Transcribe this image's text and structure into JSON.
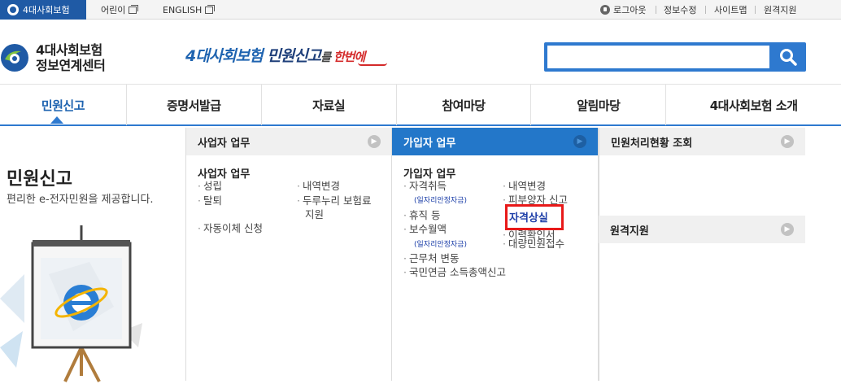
{
  "topbar": {
    "home_tab": "4대사회보험",
    "kids": "어린이",
    "english": "ENGLISH",
    "logout": "로그아웃",
    "edit_info": "정보수정",
    "sitemap": "사이트맵",
    "remote": "원격지원"
  },
  "header": {
    "brand_line1": "4대사회보험",
    "brand_line2": "정보연계센터",
    "slogan_part1": "4대사회보험",
    "slogan_part2": " 민원신고",
    "slogan_part3": "를 ",
    "slogan_part4": "한번에",
    "search_placeholder": ""
  },
  "gnb": {
    "items": [
      "민원신고",
      "증명서발급",
      "자료실",
      "참여마당",
      "알림마당",
      "4대사회보험 소개"
    ],
    "active_index": 0
  },
  "left_panel": {
    "title": "민원신고",
    "desc": "편리한 e-전자민원을 제공합니다."
  },
  "col1": {
    "header": "사업자 업무",
    "sub_title": "사업자 업무",
    "links": [
      "성립",
      "탈퇴",
      "자동이체 신청",
      "내역변경",
      "두루누리 보험료",
      "지원"
    ]
  },
  "col2": {
    "header": "가입자 업무",
    "sub_title": "가입자 업무",
    "links_left": [
      "자격취득",
      "휴직 등",
      "보수월액",
      "근무처 변동",
      "국민연금 소득총액신고"
    ],
    "tags": [
      "(일자리안정자금)",
      "(일자리안정자금)"
    ],
    "links_right": [
      "내역변경",
      "피부양자 신고",
      "자격상실",
      "이력확인서",
      "대량민원접수"
    ]
  },
  "col3": {
    "header1": "민원처리현황 조회",
    "header2": "원격지원"
  },
  "colors": {
    "brand_blue": "#1f5aa5",
    "accent_blue": "#2e79cf",
    "highlight_red": "#e81919"
  }
}
